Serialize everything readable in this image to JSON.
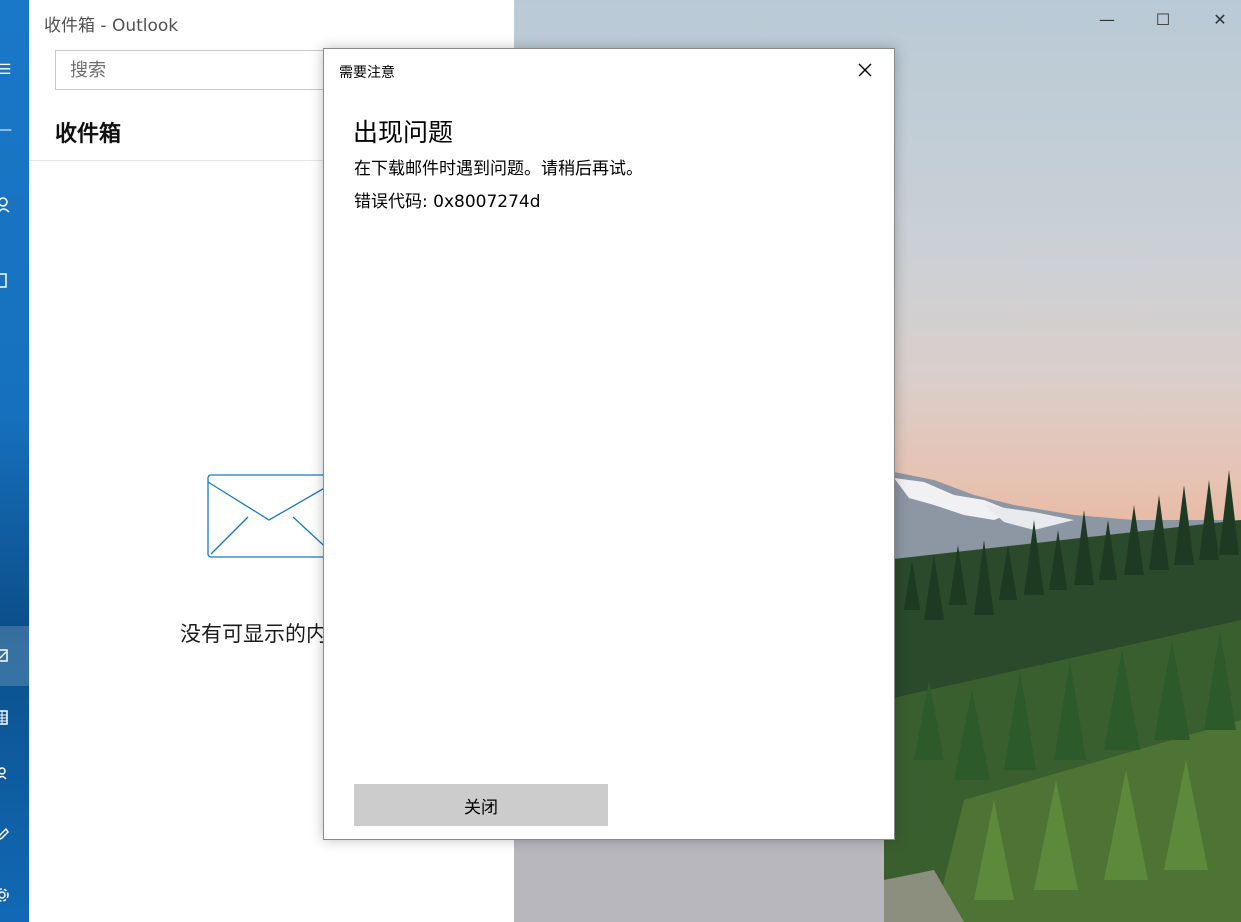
{
  "window": {
    "title": "收件箱 - Outlook"
  },
  "search": {
    "placeholder": "搜索"
  },
  "mail_list": {
    "heading": "收件箱",
    "empty_text": "没有可显示的内容"
  },
  "rail_icons": [
    "hamburger-icon",
    "plus-icon",
    "person-icon",
    "folder-icon",
    "mail-icon",
    "calendar-icon",
    "people-icon",
    "edit-icon",
    "gear-icon"
  ],
  "dialog": {
    "title": "需要注意",
    "heading": "出现问题",
    "message": "在下载邮件时遇到问题。请稍后再试。",
    "error_code": "错误代码: 0x8007274d",
    "close_button": "关闭"
  },
  "colors": {
    "accent": "#1a78c9",
    "button_bg": "#cccccc",
    "envelope_stroke": "#1a78c9"
  }
}
